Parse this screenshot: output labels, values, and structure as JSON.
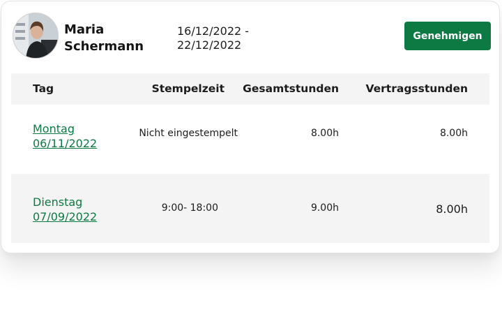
{
  "employee": {
    "name_first": "Maria",
    "name_last": "Schermann"
  },
  "period": {
    "start": "16/12/2022 -",
    "end": "22/12/2022"
  },
  "actions": {
    "approve_label": "Genehmigen"
  },
  "table": {
    "headers": {
      "day": "Tag",
      "punch": "Stempelzeit",
      "total": "Gesamtstunden",
      "contract": "Vertragsstunden"
    },
    "rows": [
      {
        "weekday": "Montag",
        "date": "06/11/2022",
        "punch": "Nicht eingestempelt",
        "total": "8.00h",
        "contract": "8.00h"
      },
      {
        "weekday": "Dienstag",
        "date": "07/09/2022",
        "punch": "9:00- 18:00",
        "total": "9.00h",
        "contract": "8.00h"
      }
    ]
  },
  "colors": {
    "accent": "#0e7a43",
    "header_bg": "#f4f4f4"
  }
}
